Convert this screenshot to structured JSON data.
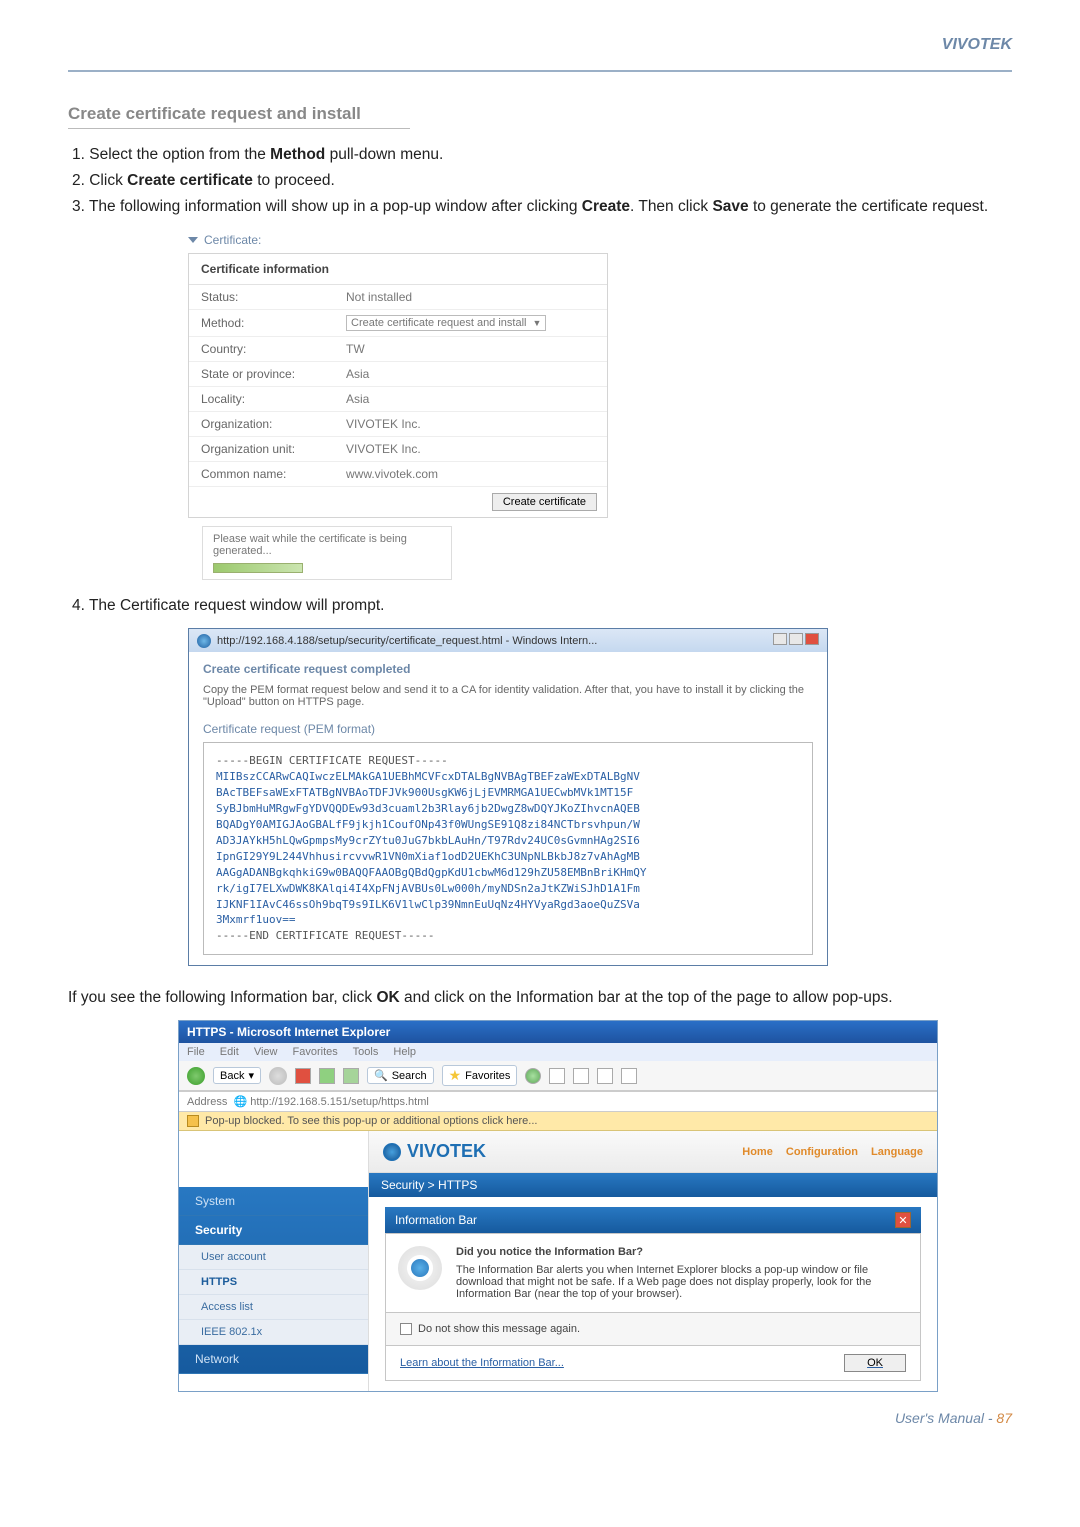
{
  "brand": "VIVOTEK",
  "section_title": "Create certificate request and install",
  "steps": {
    "s1a": "1. Select the option from the ",
    "s1b": "Method",
    "s1c": " pull-down menu.",
    "s2a": "2. Click ",
    "s2b": "Create certificate",
    "s2c": " to proceed.",
    "s3a": "3. The following information will show up in a pop-up window after clicking ",
    "s3b": "Create",
    "s3c": ". Then click ",
    "s3d": "Save",
    "s3e": " to generate the certificate request."
  },
  "fig1": {
    "heading": "Certificate:",
    "box_title": "Certificate information",
    "rows": {
      "status_l": "Status:",
      "status_v": "Not installed",
      "method_l": "Method:",
      "method_v": "Create certificate request and install",
      "country_l": "Country:",
      "country_v": "TW",
      "state_l": "State or province:",
      "state_v": "Asia",
      "locality_l": "Locality:",
      "locality_v": "Asia",
      "org_l": "Organization:",
      "org_v": "VIVOTEK Inc.",
      "ou_l": "Organization unit:",
      "ou_v": "VIVOTEK Inc.",
      "cn_l": "Common name:",
      "cn_v": "www.vivotek.com"
    },
    "create_btn": "Create certificate",
    "wait": "Please wait while the certificate is being generated..."
  },
  "step4": "4. The Certificate request window will prompt.",
  "fig2": {
    "titlebar": "http://192.168.4.188/setup/security/certificate_request.html - Windows Intern...",
    "h1": "Create certificate request completed",
    "sub": "Copy the PEM format request below and send it to a CA for identity validation. After that, you have to install it by clicking the \"Upload\" button on HTTPS page.",
    "h2": "Certificate request (PEM format)",
    "begin": "-----BEGIN CERTIFICATE REQUEST-----",
    "l1": "MIIBszCCARwCAQIwczELMAkGA1UEBhMCVFcxDTALBgNVBAgTBEFzaWExDTALBgNV",
    "l2": "BAcTBEFsaWExFTATBgNVBAoTDFJVk900UsgKW6jLjEVMRMGA1UECwbMVk1MT15F",
    "l3": "SyBJbmHuMRgwFgYDVQQDEw93d3cuaml2b3Rlay6jb2DwgZ8wDQYJKoZIhvcnAQEB",
    "l4": "BQADgY0AMIGJAoGBALfF9jkjh1CoufONp43f0WUngSE91Q8zi84NCTbrsvhpun/W",
    "l5": "AD3JAYkH5hLQwGpmpsMy9crZYtu0JuG7bkbLAuHn/T97Rdv24UC0sGvmnHAg2SI6",
    "l6": "IpnGI29Y9L244VhhusircvvwR1VN0mXiaf1odD2UEKhC3UNpNLBkbJ8z7vAhAgMB",
    "l7": "AAGgADANBgkqhkiG9w0BAQQFAAOBgQBdQgpKdU1cbwM6d129hZU58EMBnBriKHmQY",
    "l8": "rk/igI7ELXwDWK8KAlqi4I4XpFNjAVBUs0Lw000h/myNDSn2aJtKZWiSJhD1A1Fm",
    "l9": "IJKNF1IAvC46ssOh9bqT9s9ILK6V1lwClp39NmnEuUqNz4HYVyaRgd3aoeQuZSVa",
    "l10": "3Mxmrf1uov==",
    "end": "-----END CERTIFICATE REQUEST-----"
  },
  "para2a": "If you see the following Information bar, click ",
  "para2b": "OK",
  "para2c": " and click on the Information bar at the top of the page to allow pop-ups.",
  "fig3": {
    "title": "HTTPS - Microsoft Internet Explorer",
    "menu": {
      "file": "File",
      "edit": "Edit",
      "view": "View",
      "fav": "Favorites",
      "tools": "Tools",
      "help": "Help"
    },
    "toolbar": {
      "back": "Back",
      "search": "Search",
      "favorites": "Favorites"
    },
    "addr_l": "Address",
    "addr_v": "http://192.168.5.151/setup/https.html",
    "popup": "Pop-up blocked. To see this pop-up or additional options click here...",
    "logo": "VIVOTEK",
    "nav_home": "Home",
    "nav_conf": "Configuration",
    "nav_lang": "Language",
    "crumb": "Security > HTTPS",
    "side": {
      "system": "System",
      "security": "Security",
      "ua": "User account",
      "https": "HTTPS",
      "al": "Access list",
      "ieee": "IEEE 802.1x",
      "network": "Network"
    },
    "infobar": "Information Bar",
    "q": "Did you notice the Information Bar?",
    "msg": "The Information Bar alerts you when Internet Explorer blocks a pop-up window or file download that might not be safe. If a Web page does not display properly, look for the Information Bar (near the top of your browser).",
    "cb": "Do not show this message again.",
    "learn": "Learn about the Information Bar...",
    "ok": "OK"
  },
  "footer_label": "User's Manual - ",
  "footer_page": "87"
}
